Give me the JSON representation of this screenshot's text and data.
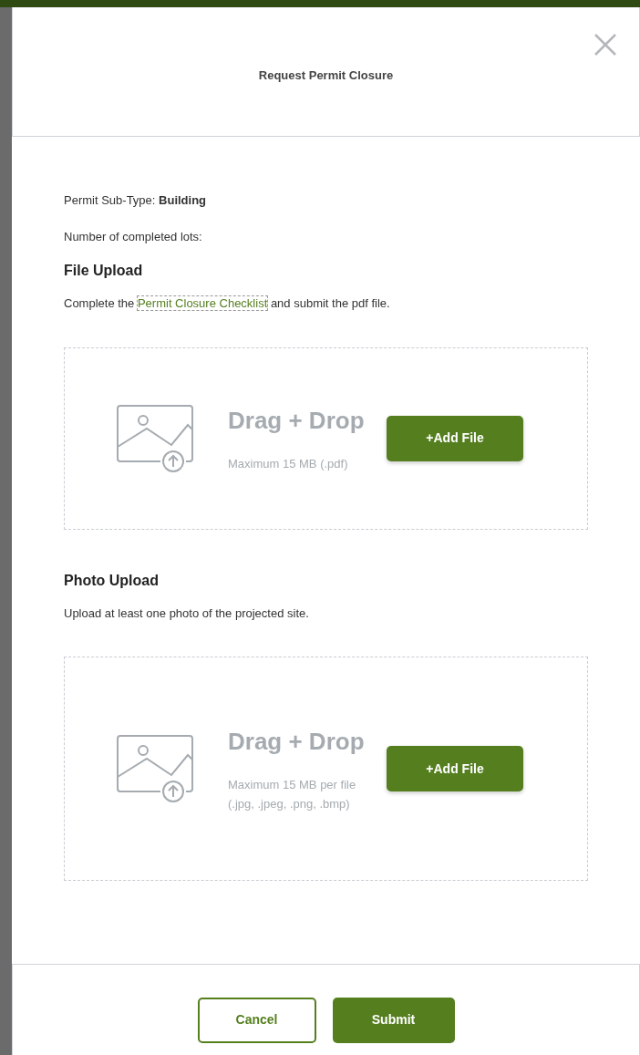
{
  "modal": {
    "title": "Request Permit Closure"
  },
  "details": [
    "Permit Sub-Type: **Building**",
    "Number of completed lots:"
  ],
  "sections": [
    {
      "heading": "File Upload",
      "instruction": {
        "before": "Complete the ",
        "link": "Permit Closure Checklist",
        "after": " and submit the pdf file."
      },
      "dropzone": {
        "title": "Drag + Drop",
        "hint": "Maximum 15 MB (.pdf)",
        "button": "+Add File"
      }
    },
    {
      "heading": "Photo Upload",
      "instruction": {
        "before": "Upload at least one photo of the projected site."
      },
      "dropzone": {
        "title": "Drag + Drop",
        "hint": "Maximum 15 MB per file (.jpg, .jpeg, .png, .bmp)",
        "button": "+Add File"
      }
    }
  ],
  "footer": {
    "buttons": [
      {
        "label": "Cancel",
        "kind": "outline"
      },
      {
        "label": "Submit",
        "kind": "primary"
      }
    ]
  }
}
